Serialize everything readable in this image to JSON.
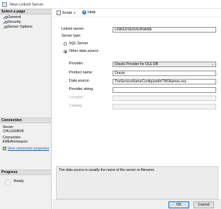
{
  "window": {
    "title": "New Linked Server"
  },
  "left_panel": {
    "select_page_header": "Select a page",
    "pages": [
      {
        "label": "General",
        "icon": "wrench-icon"
      },
      {
        "label": "Security",
        "icon": "wrench-icon"
      },
      {
        "label": "Server Options",
        "icon": "wrench-icon"
      }
    ],
    "connection_header": "Connection",
    "server_label": "Server:",
    "server_value": "CHLUGDBV6",
    "connection_label": "Connection:",
    "connection_value": "EMEA\\rimeazzo",
    "view_connection_link": "View connection properties",
    "progress_header": "Progress",
    "progress_status": "Ready"
  },
  "toolbar": {
    "script_label": "Script",
    "help_label": "Help"
  },
  "form": {
    "linked_server_label": "Linked server:",
    "linked_server_value": "LINKEDSERVERNAME",
    "server_type_label": "Server type:",
    "radio_sql_server": "SQL Server",
    "radio_other": "Other data source",
    "selected_server_type": "Other data source",
    "provider_label": "Provider:",
    "provider_value": "Oracle Provider for OLE DB",
    "product_name_label": "Product name:",
    "product_name_value": "Oracle",
    "data_source_label": "Data source:",
    "data_source_value": "TheServiceNameConfiguredInTNSNames.ora",
    "provider_string_label": "Provider string:",
    "provider_string_value": "",
    "location_label": "Location:",
    "catalog_label": "Catalog:"
  },
  "info_text": "The data source is usually the name of the server or filename.",
  "buttons": {
    "ok": "OK",
    "cancel": "Cancel"
  }
}
